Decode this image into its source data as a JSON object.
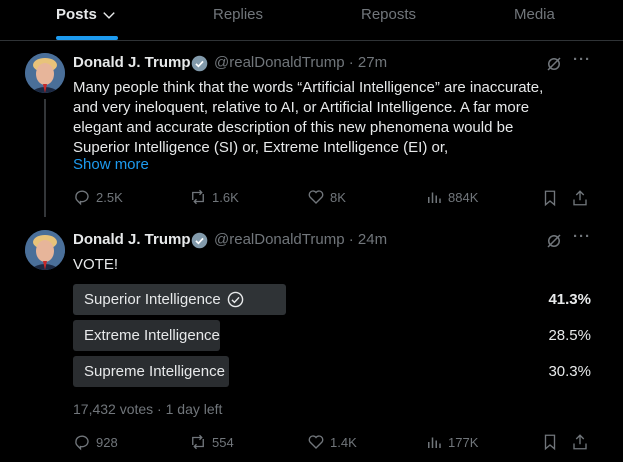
{
  "tabs": [
    {
      "label": "Posts"
    },
    {
      "label": "Replies"
    },
    {
      "label": "Reposts"
    },
    {
      "label": "Media"
    }
  ],
  "accent_color": "#1d9bf0",
  "post1": {
    "name": "Donald J. Trump",
    "handle_time": "@realDonaldTrump · 27m",
    "text_lines": [
      "Many people think that the words “Artificial Intelligence” are inaccurate,",
      "and very ineloquent, relative to AI, or Artificial Intelligence. A far more",
      "elegant and accurate description of this new phenomena would be",
      "Superior Intelligence (SI) or, Extreme Intelligence (EI) or,"
    ],
    "show_more": "Show more",
    "actions": {
      "replies": "2.5K",
      "reposts": "1.6K",
      "likes": "8K",
      "views": "884K"
    }
  },
  "post2": {
    "name": "Donald J. Trump",
    "handle_time": "@realDonaldTrump · 24m",
    "text": "VOTE!",
    "poll": {
      "options": [
        {
          "label": "Superior Intelligence",
          "percent": "41.3%",
          "value": 41.3,
          "winner": true
        },
        {
          "label": "Extreme Intelligence",
          "percent": "28.5%",
          "value": 28.5,
          "winner": false
        },
        {
          "label": "Supreme Intelligence",
          "percent": "30.3%",
          "value": 30.3,
          "winner": false
        }
      ],
      "meta": "17,432 votes · 1 day left"
    },
    "actions": {
      "replies": "928",
      "reposts": "554",
      "likes": "1.4K",
      "views": "177K"
    }
  }
}
